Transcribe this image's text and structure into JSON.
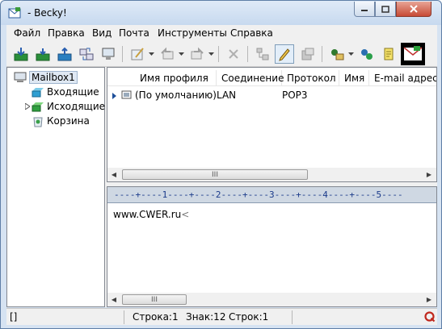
{
  "window": {
    "title": "- Becky!"
  },
  "menu": [
    "Файл",
    "Правка",
    "Вид",
    "Почта",
    "Инструменты",
    "Справка"
  ],
  "tree": {
    "mailbox": "Mailbox1",
    "folders": [
      "Входящие",
      "Исходящие",
      "Корзина"
    ]
  },
  "list": {
    "columns": [
      "Имя профиля",
      "Соединение",
      "Протокол",
      "Имя",
      "E-mail адрес"
    ],
    "rows": [
      {
        "profile": "(По умолчанию)",
        "connection": "LAN",
        "protocol": "POP3",
        "name": "",
        "email": ""
      }
    ]
  },
  "editor": {
    "ruler": "----+----1----+----2----+----3----+----4----+----5----",
    "body": "www.CWER.ru",
    "caret_mark": "<"
  },
  "status": {
    "left": "[]",
    "line": "Строка:1",
    "chars": "Знак:12",
    "lines": "Строк:1"
  },
  "scrollbar_thumb_grip": "III",
  "colors": {
    "accent": "#1a3a8a",
    "close_button": "#c74a35",
    "selection": "#dfe8f3"
  }
}
